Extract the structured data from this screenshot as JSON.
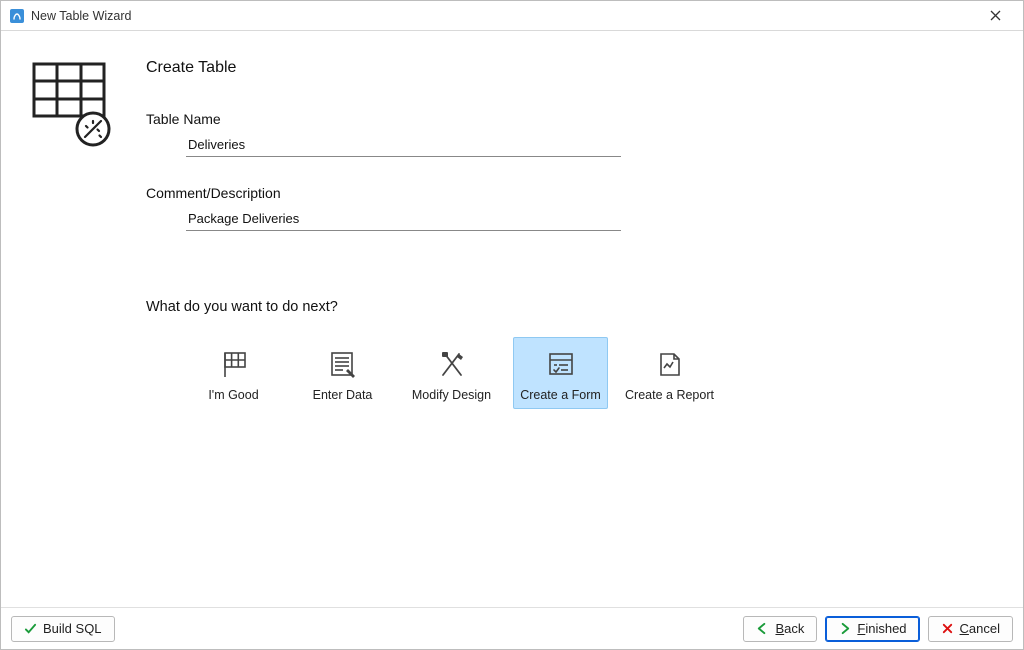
{
  "window": {
    "title": "New Table Wizard"
  },
  "page": {
    "heading": "Create Table",
    "table_name_label": "Table Name",
    "table_name_value": "Deliveries",
    "comment_label": "Comment/Description",
    "comment_value": "Package Deliveries",
    "next_heading": "What do you want to do next?"
  },
  "options": [
    {
      "label": "I'm Good",
      "icon": "flag-grid-icon",
      "selected": false
    },
    {
      "label": "Enter Data",
      "icon": "sheet-edit-icon",
      "selected": false
    },
    {
      "label": "Modify Design",
      "icon": "tools-icon",
      "selected": false
    },
    {
      "label": "Create a Form",
      "icon": "form-icon",
      "selected": true
    },
    {
      "label": "Create a Report",
      "icon": "report-icon",
      "selected": false
    }
  ],
  "footer": {
    "build_sql": "Build SQL",
    "back": "Back",
    "back_underline_letter": "B",
    "finished": "Finished",
    "finished_underline_letter": "F",
    "cancel": "Cancel",
    "cancel_underline_letter": "C"
  }
}
